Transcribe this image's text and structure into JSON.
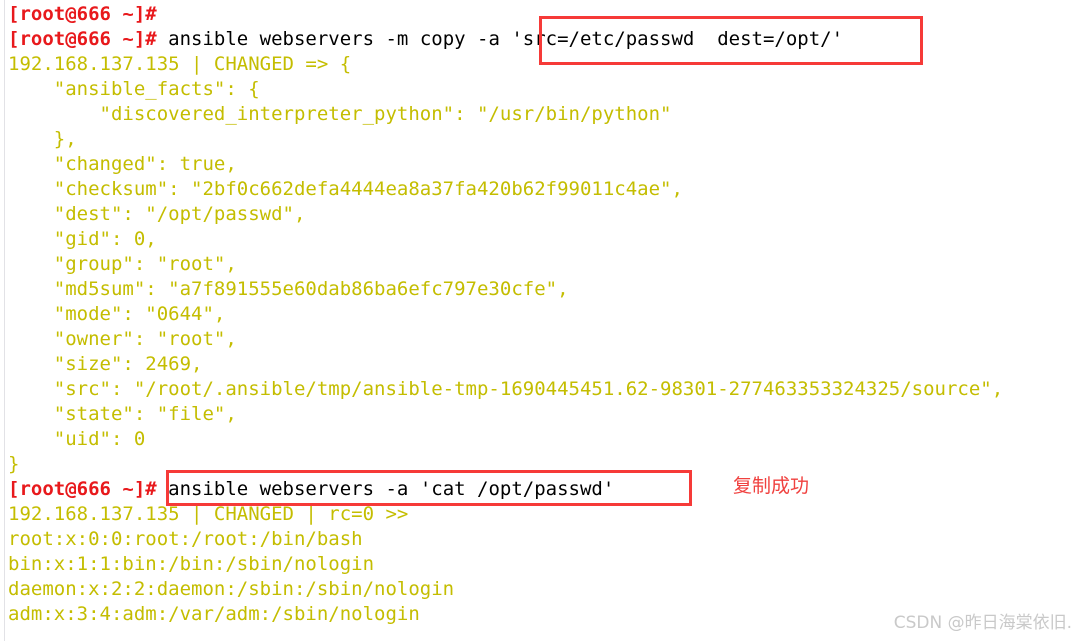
{
  "terminal": {
    "host_prompt": "[root@666 ~]#",
    "lines": [
      {
        "type": "prompt_only",
        "prompt": "[root@666 ~]#",
        "command": ""
      },
      {
        "type": "command",
        "prompt": "[root@666 ~]#",
        "command": " ansible webservers -m copy -a 'src=/etc/passwd  dest=/opt/'"
      },
      {
        "type": "output",
        "text": "192.168.137.135 | CHANGED => {"
      },
      {
        "type": "output",
        "text": "    \"ansible_facts\": {"
      },
      {
        "type": "output",
        "text": "        \"discovered_interpreter_python\": \"/usr/bin/python\""
      },
      {
        "type": "output",
        "text": "    },"
      },
      {
        "type": "output",
        "text": "    \"changed\": true,"
      },
      {
        "type": "output",
        "text": "    \"checksum\": \"2bf0c662defa4444ea8a37fa420b62f99011c4ae\","
      },
      {
        "type": "output",
        "text": "    \"dest\": \"/opt/passwd\","
      },
      {
        "type": "output",
        "text": "    \"gid\": 0,"
      },
      {
        "type": "output",
        "text": "    \"group\": \"root\","
      },
      {
        "type": "output",
        "text": "    \"md5sum\": \"a7f891555e60dab86ba6efc797e30cfe\","
      },
      {
        "type": "output",
        "text": "    \"mode\": \"0644\","
      },
      {
        "type": "output",
        "text": "    \"owner\": \"root\","
      },
      {
        "type": "output",
        "text": "    \"size\": 2469,"
      },
      {
        "type": "output",
        "text": "    \"src\": \"/root/.ansible/tmp/ansible-tmp-1690445451.62-98301-277463353324325/source\","
      },
      {
        "type": "output",
        "text": "    \"state\": \"file\","
      },
      {
        "type": "output",
        "text": "    \"uid\": 0"
      },
      {
        "type": "output",
        "text": "}"
      },
      {
        "type": "command",
        "prompt": "[root@666 ~]#",
        "command": " ansible webservers -a 'cat /opt/passwd'"
      },
      {
        "type": "output",
        "text": "192.168.137.135 | CHANGED | rc=0 >>"
      },
      {
        "type": "output",
        "text": "root:x:0:0:root:/root:/bin/bash"
      },
      {
        "type": "output",
        "text": "bin:x:1:1:bin:/bin:/sbin/nologin"
      },
      {
        "type": "output",
        "text": "daemon:x:2:2:daemon:/sbin:/sbin/nologin"
      },
      {
        "type": "output",
        "text": "adm:x:3:4:adm:/var/adm:/sbin/nologin"
      }
    ]
  },
  "annotations": {
    "highlight_copy_args": "src=/etc/passwd  dest=/opt/'",
    "highlight_cat_command": "ansible webservers -a 'cat /opt/passwd'",
    "copy_success_note": "复制成功"
  },
  "watermark": {
    "text": "CSDN @昨日海棠依旧."
  },
  "colors": {
    "prompt_red": "#e8191c",
    "output_yellow": "#c4bd00",
    "command_black": "#000000",
    "highlight_box_red": "#f63a38",
    "annotation_red": "#f0413f",
    "background": "#ffffff",
    "watermark_gray": "#c9c9c9"
  }
}
